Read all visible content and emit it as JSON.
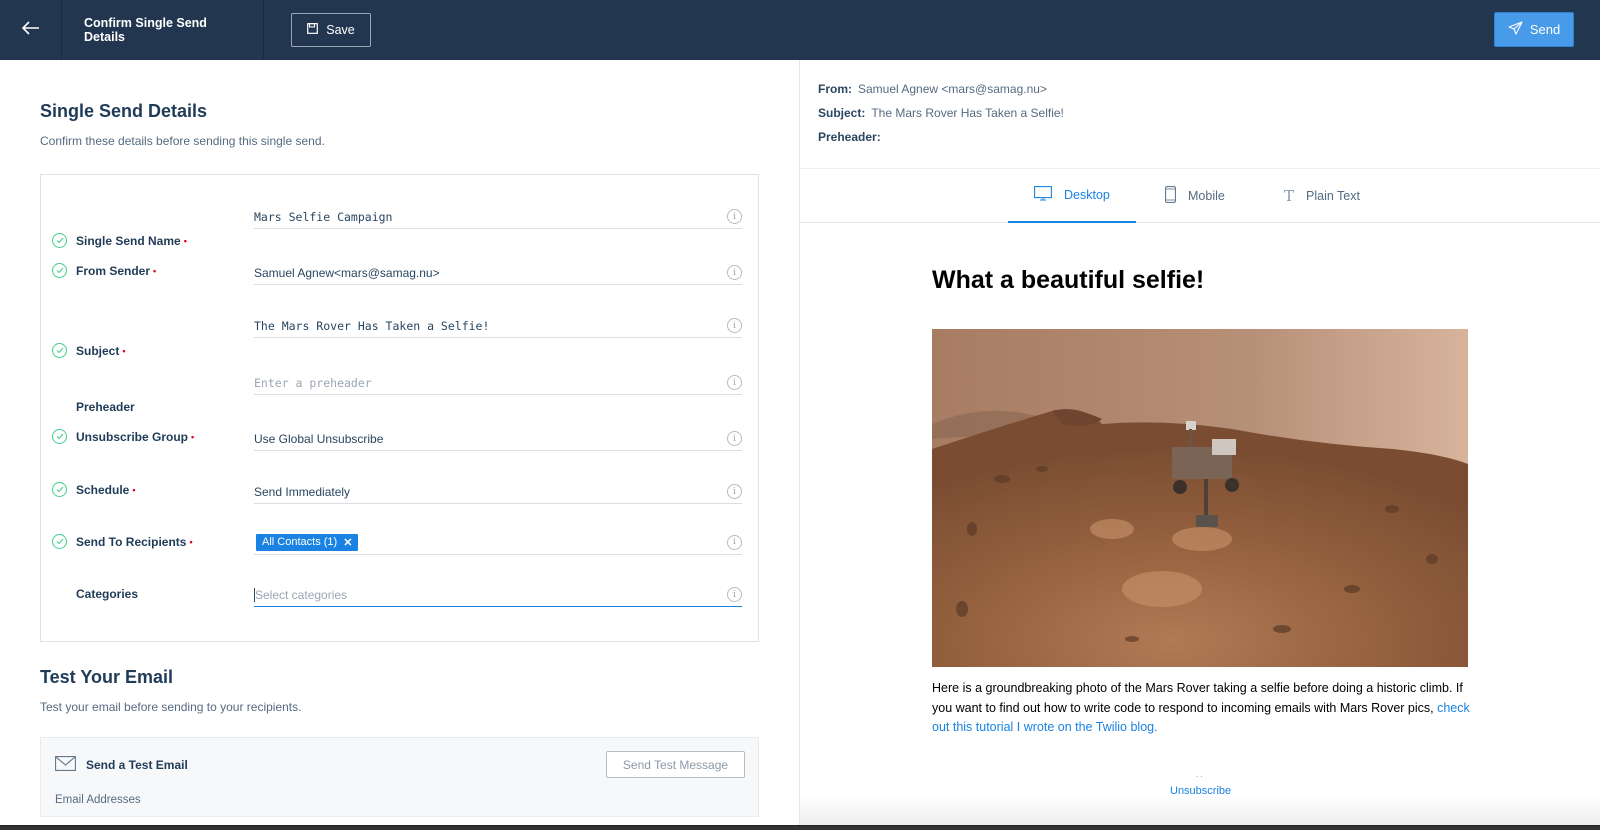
{
  "topbar": {
    "back_icon": "arrow-left-icon",
    "title": "Confirm Single Send Details",
    "save_label": "Save",
    "save_icon": "floppy-disk-icon",
    "send_label": "Send",
    "send_icon": "paper-plane-icon"
  },
  "details": {
    "title": "Single Send Details",
    "subtitle": "Confirm these details before sending this single send.",
    "rows": [
      {
        "label": "Single Send Name",
        "required": true,
        "checked": true,
        "value": "Mars Selfie Campaign",
        "mono": true
      },
      {
        "label": "From Sender",
        "required": true,
        "checked": true,
        "value": "Samuel Agnew<mars@samag.nu>"
      },
      {
        "label": "Subject",
        "required": true,
        "checked": true,
        "value": "The Mars Rover Has Taken a Selfie!",
        "mono": true
      },
      {
        "label": "Preheader",
        "required": false,
        "checked": false,
        "placeholder": "Enter a preheader",
        "value": ""
      },
      {
        "label": "Unsubscribe Group",
        "required": true,
        "checked": true,
        "value": "Use Global Unsubscribe"
      },
      {
        "label": "Schedule",
        "required": true,
        "checked": true,
        "value": "Send Immediately"
      },
      {
        "label": "Send To Recipients",
        "required": true,
        "checked": true,
        "tag": "All Contacts (1)"
      },
      {
        "label": "Categories",
        "required": false,
        "checked": false,
        "placeholder": "Select categories",
        "value": ""
      }
    ],
    "required_mark": "•",
    "info_glyph": "i"
  },
  "test": {
    "title": "Test Your Email",
    "subtitle": "Test your email before sending to your recipients.",
    "box_title": "Send a Test Email",
    "box_icon": "envelope-icon",
    "button_label": "Send Test Message",
    "email_label": "Email Addresses"
  },
  "preview_meta": {
    "from_label": "From:",
    "from_value": "Samuel Agnew <mars@samag.nu>",
    "subject_label": "Subject:",
    "subject_value": "The Mars Rover Has Taken a Selfie!",
    "preheader_label": "Preheader:",
    "preheader_value": ""
  },
  "tabs": [
    {
      "label": "Desktop",
      "icon": "desktop-icon",
      "active": true
    },
    {
      "label": "Mobile",
      "icon": "mobile-icon",
      "active": false
    },
    {
      "label": "Plain Text",
      "icon": "text-icon",
      "active": false
    }
  ],
  "email": {
    "heading": "What a beautiful selfie!",
    "image_alt": "Mars Rover selfie on Martian terrain",
    "body_text": "Here is a groundbreaking photo of the Mars Rover taking a selfie before doing a historic climb. If you want to find out how to write code to respond to incoming emails with Mars Rover pics, ",
    "link_text": "check out this tutorial I wrote on the Twilio blog.",
    "dots": ". .",
    "unsubscribe": "Unsubscribe"
  },
  "colors": {
    "topbar": "#22364f",
    "accent": "#1a82e2",
    "send_button": "#489be8",
    "check": "#3ecf8e",
    "required": "#e2001a"
  }
}
